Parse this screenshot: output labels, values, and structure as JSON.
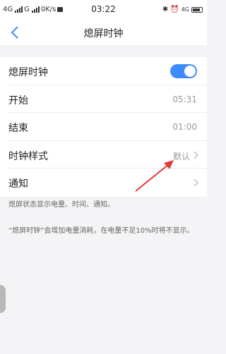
{
  "status_bar": {
    "left_text_1": "4G",
    "left_text_2": "G",
    "speed": "0K/s",
    "time": "03:22",
    "net_label": "4G"
  },
  "nav": {
    "title": "熄屏时钟"
  },
  "settings": {
    "rows": [
      {
        "label": "熄屏时钟",
        "toggle_on": true
      },
      {
        "label": "开始",
        "value": "05:31"
      },
      {
        "label": "结束",
        "value": "01:00"
      },
      {
        "label": "时钟样式",
        "value": "默认"
      },
      {
        "label": "通知",
        "value": ""
      }
    ]
  },
  "description": "熄屏状态显示电量、时间、通知。",
  "note": "“熄屏时钟”会增加电量消耗，在电量不足10%时将不显示。",
  "colors": {
    "accent": "#3d8bfd",
    "annotation_arrow": "#e53935",
    "background": "#f4f4f6"
  }
}
